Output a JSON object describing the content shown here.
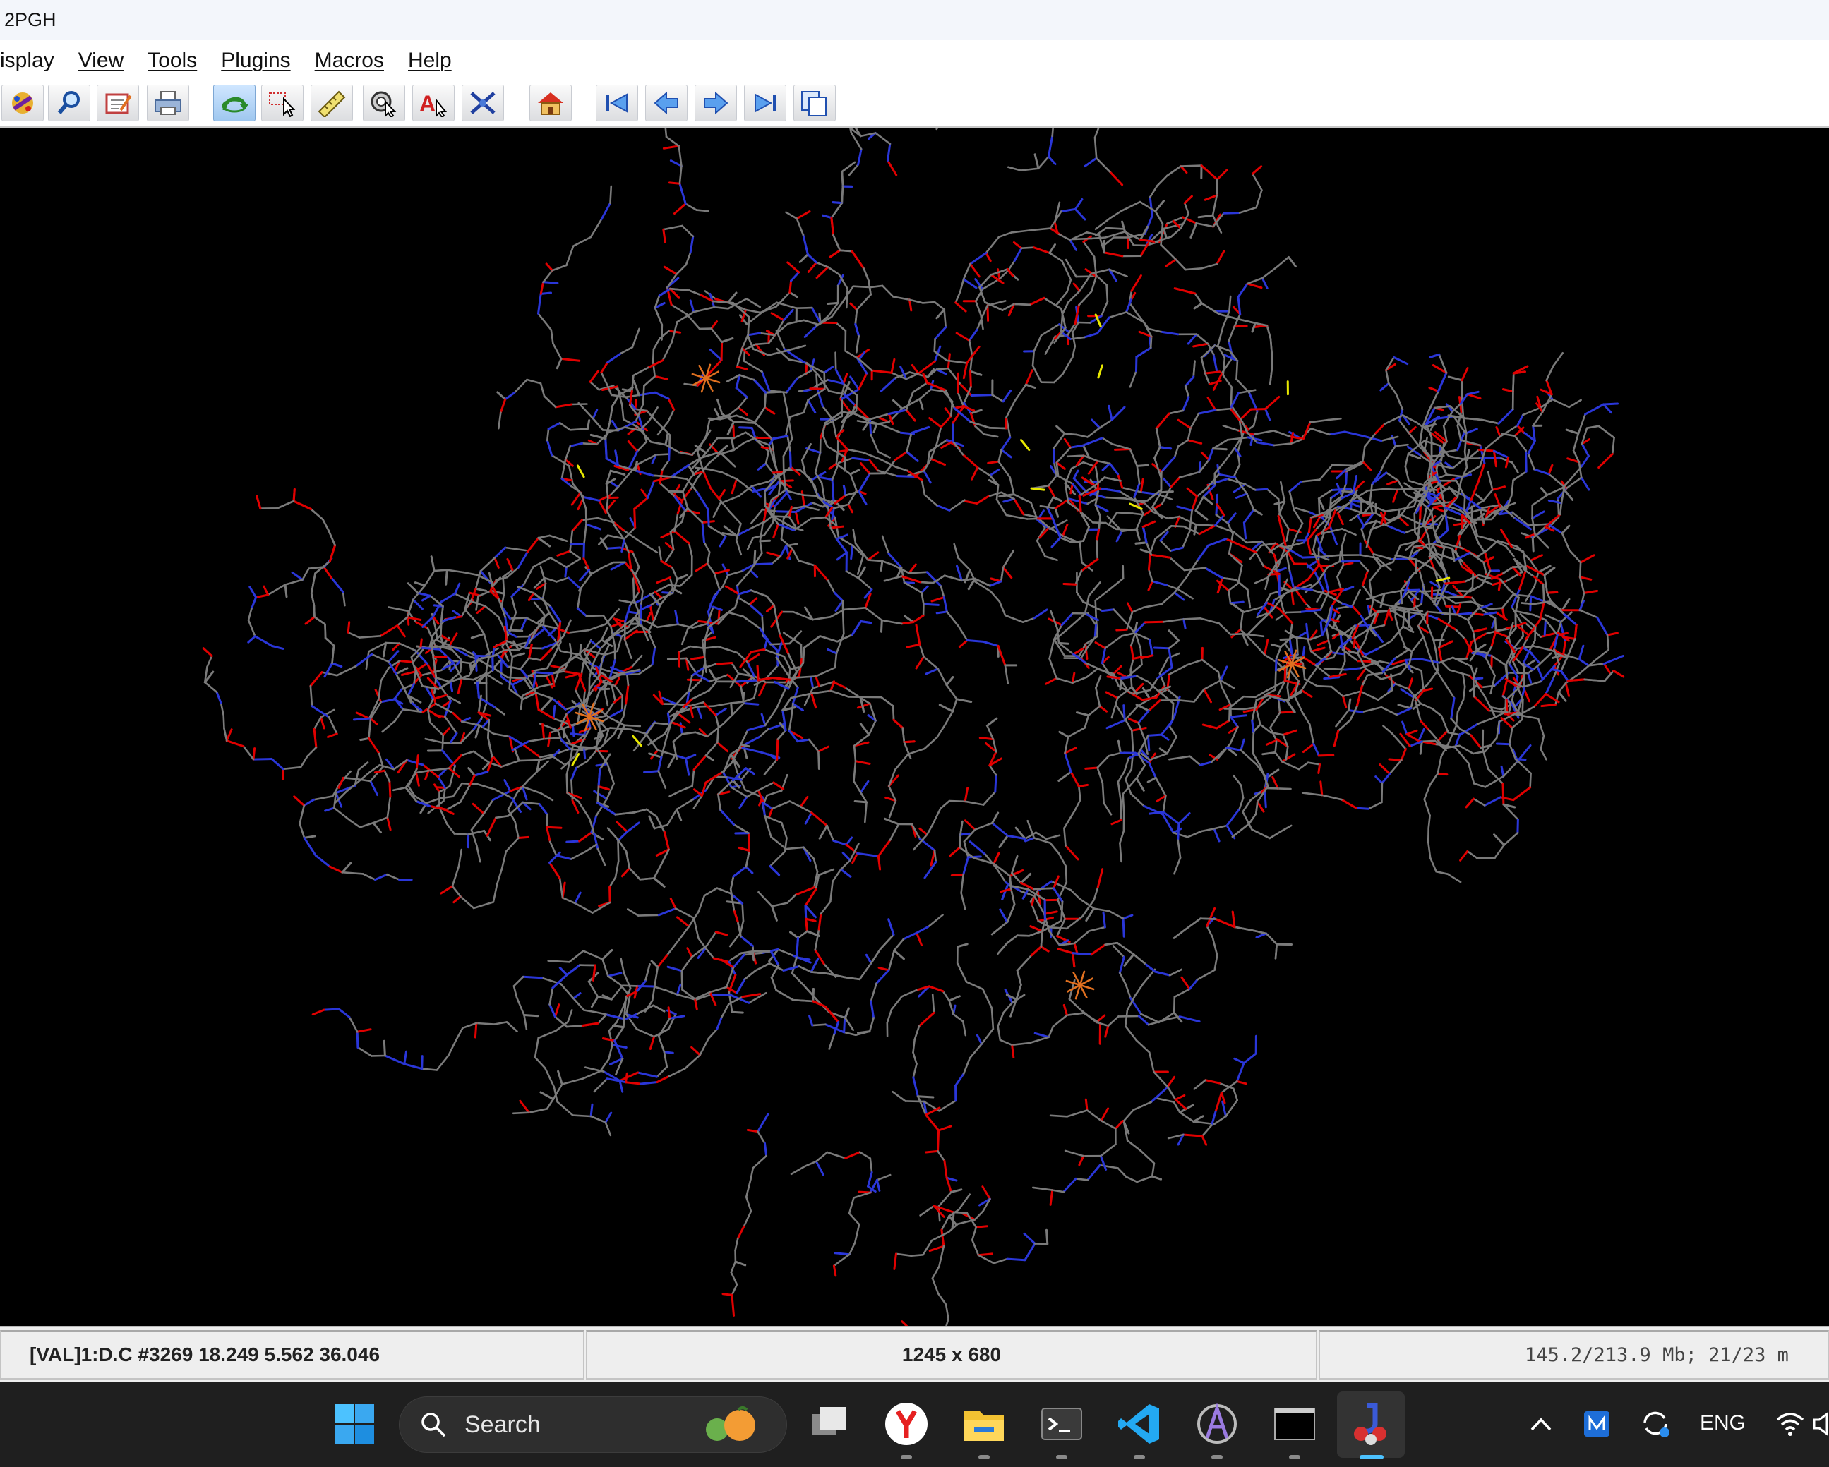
{
  "window": {
    "title": "2PGH"
  },
  "menu": {
    "items": [
      {
        "label": "isplay",
        "name": "menu-display"
      },
      {
        "label": "View",
        "name": "menu-view"
      },
      {
        "label": "Tools",
        "name": "menu-tools"
      },
      {
        "label": "Plugins",
        "name": "menu-plugins"
      },
      {
        "label": "Macros",
        "name": "menu-macros"
      },
      {
        "label": "Help",
        "name": "menu-help"
      }
    ]
  },
  "toolbar": {
    "buttons": [
      {
        "icon": "molecule-icon",
        "name": "open-molecule-button"
      },
      {
        "icon": "magnify-icon",
        "name": "inspect-button"
      },
      {
        "icon": "edit-script-icon",
        "name": "script-editor-button"
      },
      {
        "icon": "print-icon",
        "name": "print-button"
      },
      {
        "icon": "rotate-icon",
        "name": "rotate-mode-button",
        "active": true
      },
      {
        "icon": "select-cursor-icon",
        "name": "pick-mode-button"
      },
      {
        "icon": "ruler-icon",
        "name": "measure-button"
      },
      {
        "icon": "spin-cursor-icon",
        "name": "spin-button"
      },
      {
        "icon": "label-icon",
        "name": "label-button"
      },
      {
        "icon": "cross-atom-icon",
        "name": "atom-cross-button"
      },
      {
        "icon": "home-icon",
        "name": "home-view-button"
      },
      {
        "icon": "first-frame-icon",
        "name": "first-frame-button"
      },
      {
        "icon": "prev-frame-icon",
        "name": "previous-frame-button"
      },
      {
        "icon": "next-frame-icon",
        "name": "next-frame-button"
      },
      {
        "icon": "last-frame-icon",
        "name": "last-frame-button"
      },
      {
        "icon": "copy-frames-icon",
        "name": "frames-button"
      }
    ]
  },
  "status": {
    "atom_info": "[VAL]1:D.C #3269 18.249 5.562 36.046",
    "canvas_size": "1245 x 680",
    "memory": "145.2/213.9 Mb;  21/23 m"
  },
  "taskbar": {
    "search_label": "Search",
    "apps": [
      "start-icon",
      "task-view-icon",
      "yandex-browser-icon",
      "file-explorer-icon",
      "terminal-icon",
      "vscode-icon",
      "app-icon",
      "console-icon",
      "jmol-icon"
    ],
    "tray": {
      "language": "ENG"
    }
  },
  "colors": {
    "background": "#000000",
    "bond_carbon": "#7a7a7a",
    "atom_oxygen": "#e00000",
    "atom_nitrogen": "#2a36d8",
    "atom_sulfur": "#e8e800",
    "atom_iron": "#e07020"
  }
}
